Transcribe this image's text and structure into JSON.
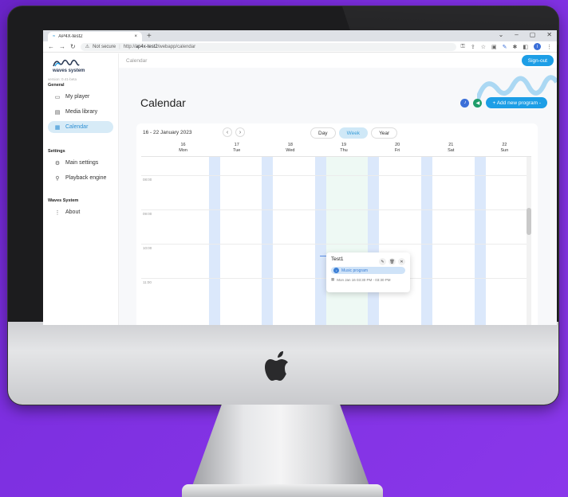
{
  "browser": {
    "tab_title": "AP4X-test2",
    "tab_close": "×",
    "new_tab": "+",
    "url_security": "Not secure",
    "url_host": "ap4x-test2",
    "url_path": "/webapp/calendar",
    "url_prefix": "http://",
    "profile_initial": "I"
  },
  "app": {
    "logo_text": "waves system",
    "version": "version: 0.41-beta",
    "sections": [
      {
        "title": "General",
        "items": [
          {
            "label": "My player",
            "icon": "player-icon"
          },
          {
            "label": "Media library",
            "icon": "media-library-icon"
          },
          {
            "label": "Calendar",
            "icon": "calendar-icon",
            "active": true
          }
        ]
      },
      {
        "title": "Settings",
        "items": [
          {
            "label": "Main settings",
            "icon": "gear-icon"
          },
          {
            "label": "Playback engine",
            "icon": "wrench-icon"
          }
        ]
      },
      {
        "title": "Waves System",
        "items": [
          {
            "label": "About",
            "icon": "more-vertical-icon"
          }
        ]
      }
    ],
    "breadcrumb": "Calendar",
    "signout_label": "Sign-out",
    "page_title": "Calendar",
    "add_program_label": "+ Add new program -",
    "accent_color": "#1d9ee6"
  },
  "calendar": {
    "range_label": "16 - 22 January 2023",
    "prev": "‹",
    "next": "›",
    "views": [
      {
        "label": "Day",
        "active": false
      },
      {
        "label": "Week",
        "active": true
      },
      {
        "label": "Year",
        "active": false
      }
    ],
    "days": [
      {
        "num": "16",
        "name": "Mon"
      },
      {
        "num": "17",
        "name": "Tue"
      },
      {
        "num": "18",
        "name": "Wed"
      },
      {
        "num": "19",
        "name": "Thu"
      },
      {
        "num": "20",
        "name": "Fri"
      },
      {
        "num": "21",
        "name": "Sat"
      },
      {
        "num": "22",
        "name": "Sun"
      }
    ],
    "hours": [
      "08:00",
      "09:00",
      "10:00",
      "11:00"
    ],
    "event": {
      "title": "Test1",
      "tag": "Music program",
      "time": "Mon Jan 16 03:30 PM - 03:30 PM"
    }
  }
}
